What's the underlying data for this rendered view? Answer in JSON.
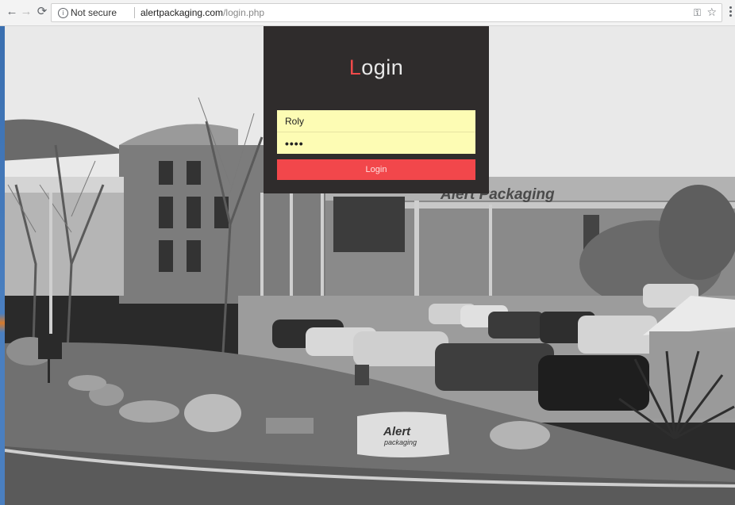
{
  "browser": {
    "security_label": "Not secure",
    "url_host": "alertpackaging.com",
    "url_path": "/login.php",
    "icons": [
      "back-icon",
      "forward-icon",
      "reload-icon",
      "info-icon",
      "key-icon",
      "star-icon",
      "menu-icon"
    ]
  },
  "scene": {
    "building_sign": "Alert Packaging",
    "rock_sign_line1": "Alert",
    "rock_sign_line2": "packaging"
  },
  "login": {
    "title_first_letter": "L",
    "title_rest": "ogin",
    "username_value": "Roly",
    "password_value": "••••",
    "button_label": "Login"
  },
  "colors": {
    "panel_bg": "#2f2c2c",
    "accent_red": "#f2474b",
    "field_bg": "#fdfcb4"
  }
}
